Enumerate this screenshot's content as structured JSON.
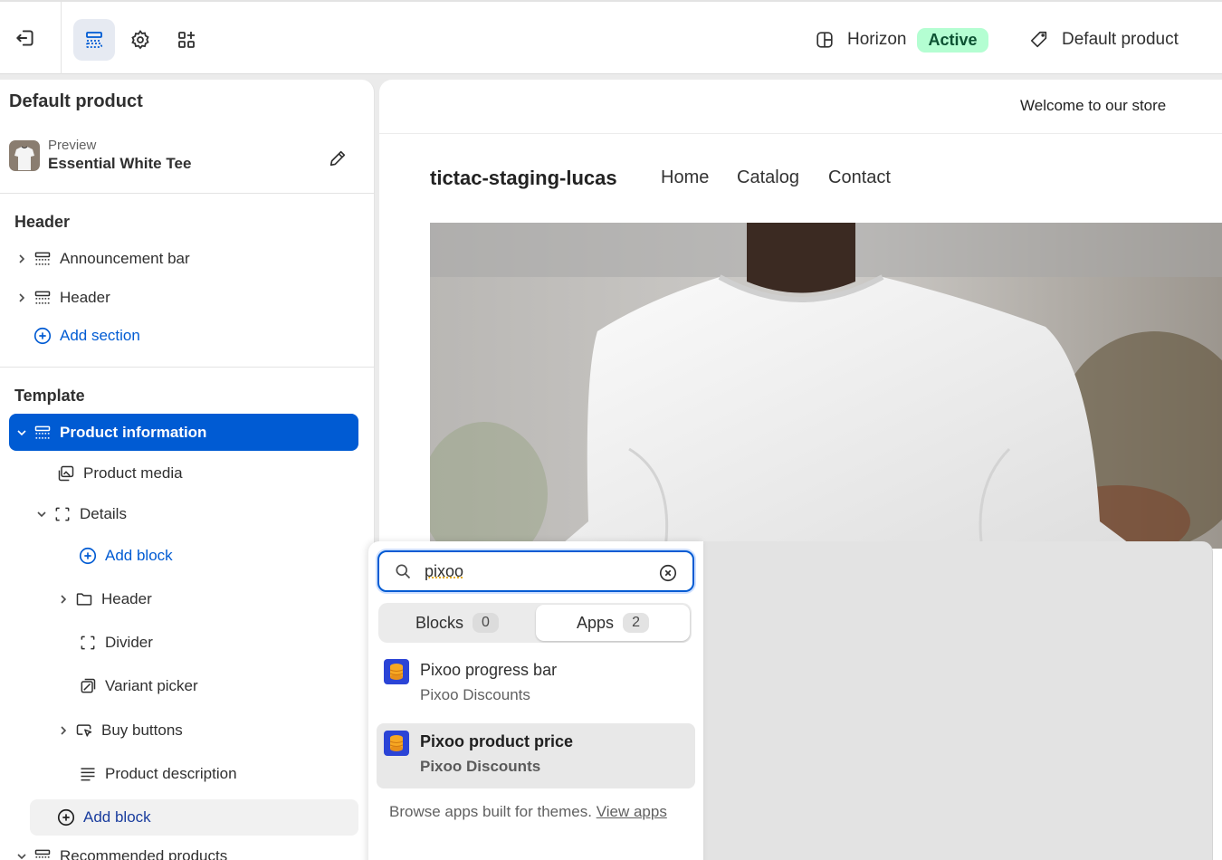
{
  "topbar": {
    "theme_name": "Horizon",
    "theme_status": "Active",
    "template_name": "Default product"
  },
  "sidebar": {
    "title": "Default product",
    "preview_label": "Preview",
    "preview_product": "Essential White Tee",
    "header_group": {
      "title": "Header",
      "items": [
        {
          "label": "Announcement bar"
        },
        {
          "label": "Header"
        }
      ],
      "add_section": "Add section"
    },
    "template_group": {
      "title": "Template",
      "selected": "Product information",
      "items": [
        {
          "label": "Product media"
        },
        {
          "label": "Details"
        },
        {
          "label": "Add block"
        },
        {
          "label": "Header"
        },
        {
          "label": "Divider"
        },
        {
          "label": "Variant picker"
        },
        {
          "label": "Buy buttons"
        },
        {
          "label": "Product description"
        }
      ],
      "add_block": "Add block",
      "next_section": "Recommended products"
    }
  },
  "canvas": {
    "announcement": "Welcome to our store",
    "store_name": "tictac-staging-lucas",
    "nav": [
      "Home",
      "Catalog",
      "Contact"
    ]
  },
  "picker": {
    "search_value": "pixoo",
    "tabs": [
      {
        "label": "Blocks",
        "count": "0"
      },
      {
        "label": "Apps",
        "count": "2"
      }
    ],
    "results": [
      {
        "title": "Pixoo progress bar",
        "app": "Pixoo Discounts"
      },
      {
        "title": "Pixoo product price",
        "app": "Pixoo Discounts"
      }
    ],
    "footer_text": "Browse apps built for themes.",
    "footer_link": "View apps"
  },
  "colors": {
    "accent": "#005bd3",
    "active_badge": "#b4fed2",
    "app_icon": "#2b44d6"
  }
}
